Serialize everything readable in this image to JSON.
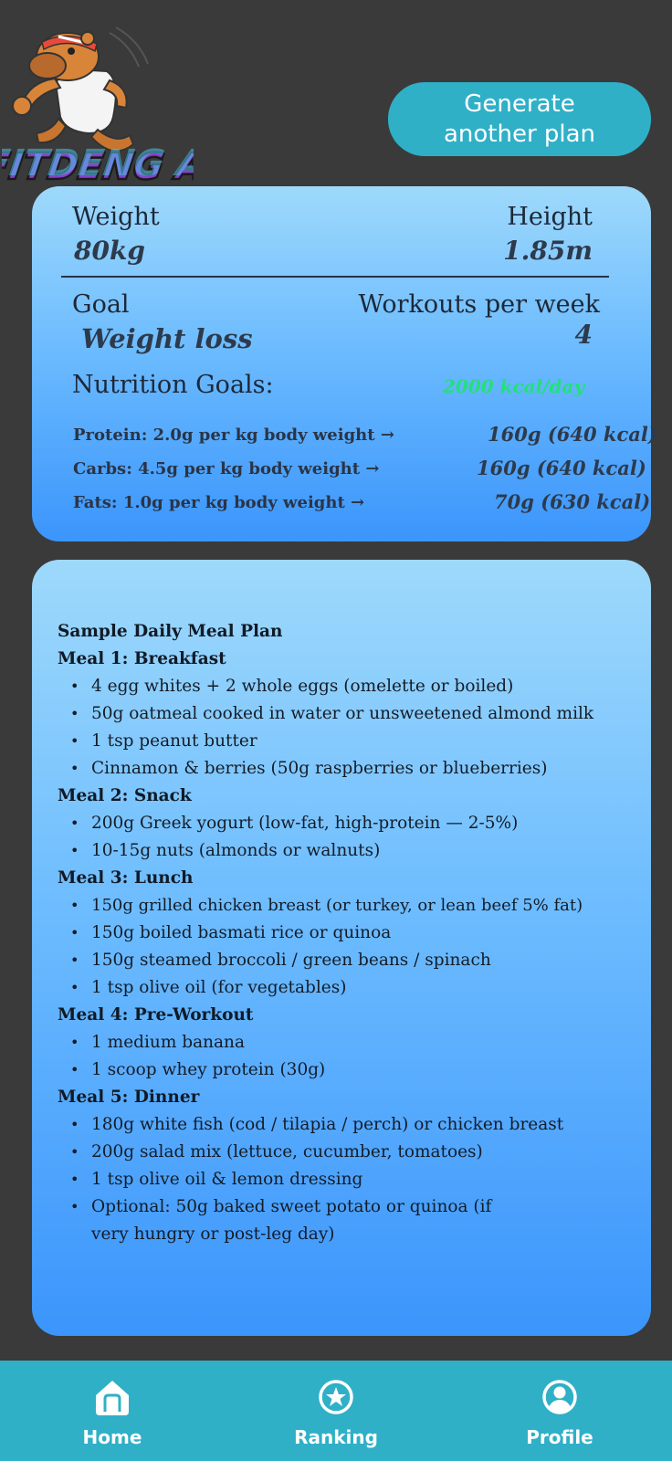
{
  "header": {
    "logo_text": "FITDENG AI",
    "generate_label": "Generate another plan"
  },
  "stats": {
    "weight_label": "Weight",
    "weight_value": "80kg",
    "height_label": "Height",
    "height_value": "1.85m",
    "goal_label": "Goal",
    "goal_value": "Weight loss",
    "workouts_label": "Workouts per week",
    "workouts_value": "4",
    "nutrition_label": "Nutrition Goals:",
    "kcal_value": "2000 kcal/day",
    "nutrients": [
      {
        "rule": "Protein: 2.0g per kg body weight →",
        "value": "160g (640 kcal)"
      },
      {
        "rule": "Carbs: 4.5g per kg body weight →",
        "value": "160g (640 kcal)"
      },
      {
        "rule": "Fats: 1.0g per kg body weight →",
        "value": "70g (630 kcal)"
      }
    ]
  },
  "meal_plan": {
    "title": "Sample Daily Meal Plan",
    "meals": [
      {
        "heading": "Meal 1: Breakfast",
        "items": [
          "4 egg whites + 2 whole eggs (omelette or boiled)",
          "50g oatmeal cooked in water or unsweetened almond milk",
          "1 tsp peanut butter",
          "Cinnamon & berries (50g raspberries or blueberries)"
        ]
      },
      {
        "heading": "Meal 2: Snack",
        "items": [
          "200g Greek yogurt (low-fat, high-protein — 2-5%)",
          "10-15g nuts (almonds or walnuts)"
        ]
      },
      {
        "heading": "Meal 3: Lunch",
        "items": [
          "150g grilled chicken breast (or turkey, or lean beef 5% fat)",
          "150g boiled basmati rice or quinoa",
          "150g steamed broccoli / green beans / spinach",
          "1 tsp olive oil (for vegetables)"
        ]
      },
      {
        "heading": "Meal 4: Pre-Workout",
        "items": [
          "1 medium banana",
          "1 scoop whey protein (30g)"
        ]
      },
      {
        "heading": "Meal 5: Dinner",
        "items": [
          "180g white fish (cod / tilapia / perch) or chicken breast",
          "200g salad mix (lettuce, cucumber, tomatoes)",
          "1 tsp olive oil & lemon dressing",
          "Optional: 50g baked sweet potato or quinoa (if very hungry or post-leg day)"
        ]
      }
    ]
  },
  "nav": {
    "items": [
      {
        "label": "Home",
        "icon": "home-icon"
      },
      {
        "label": "Ranking",
        "icon": "star-icon"
      },
      {
        "label": "Profile",
        "icon": "user-icon"
      }
    ]
  },
  "colors": {
    "background": "#3a3a3a",
    "accent": "#2fb0c7",
    "card_top": "#9ed9fb",
    "card_bottom": "#3b95fb",
    "kcal_green": "#23e07a"
  }
}
